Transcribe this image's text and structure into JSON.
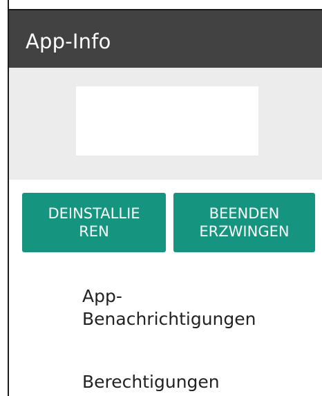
{
  "header": {
    "title": "App-Info"
  },
  "actions": {
    "uninstall": {
      "line1": "DEINSTALLIE",
      "line2": "REN"
    },
    "force_stop": {
      "line1": "BEENDEN",
      "line2": "ERZWINGEN"
    }
  },
  "menu": {
    "notifications": {
      "line1": "App-",
      "line2": "Benachrichtigungen"
    },
    "permissions": {
      "label": "Berechtigungen"
    }
  },
  "colors": {
    "header_bg": "#424242",
    "accent": "#15957f",
    "hero_bg": "#ececec"
  }
}
